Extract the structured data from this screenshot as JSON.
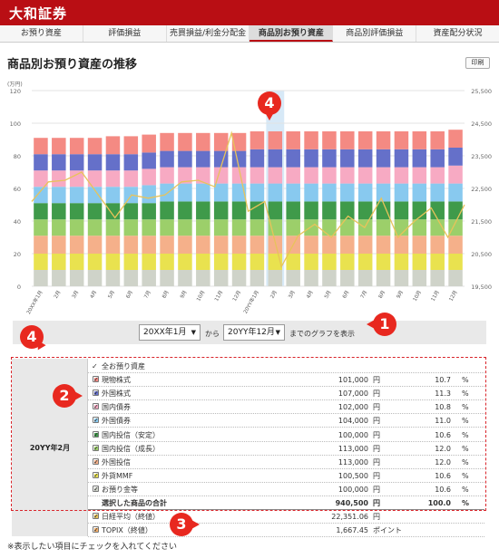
{
  "app": {
    "brand": "大和証券"
  },
  "tabs": [
    {
      "label": "お預り資産",
      "active": false
    },
    {
      "label": "評価損益",
      "active": false
    },
    {
      "label": "売買損益/利金分配金",
      "active": false
    },
    {
      "label": "商品別お預り資産",
      "active": true
    },
    {
      "label": "商品別評価損益",
      "active": false
    },
    {
      "label": "資産配分状況",
      "active": false
    }
  ],
  "page": {
    "title": "商品別お預り資産の推移",
    "print_label": "印刷"
  },
  "chart_data": {
    "type": "bar",
    "stacked": true,
    "left_axis": {
      "unit_label": "(万円)",
      "ticks": [
        "0",
        "20",
        "40",
        "60",
        "80",
        "100",
        "120"
      ],
      "ylim": [
        0,
        120
      ]
    },
    "right_axis": {
      "ticks": [
        "19,500",
        "20,500",
        "21,500",
        "22,500",
        "23,500",
        "24,500",
        "25,500"
      ],
      "ylim": [
        19500,
        25500
      ]
    },
    "categories": [
      "20XX年1月",
      "2月",
      "3月",
      "4月",
      "5月",
      "6月",
      "7月",
      "8月",
      "9月",
      "10月",
      "11月",
      "12月",
      "20YY年1月",
      "2月",
      "3月",
      "4月",
      "5月",
      "6月",
      "7月",
      "8月",
      "9月",
      "10月",
      "11月",
      "12月"
    ],
    "series": [
      {
        "color": "#cfd3c9",
        "values": [
          10,
          10,
          10,
          10,
          10,
          10,
          10,
          10,
          10,
          10,
          10,
          10,
          10,
          10,
          10,
          10,
          10,
          10,
          10,
          10,
          10,
          10,
          10,
          10
        ]
      },
      {
        "color": "#e9e24f",
        "values": [
          10,
          10,
          10,
          10,
          10,
          10,
          10,
          10,
          10,
          10,
          10,
          10,
          10,
          10,
          10,
          10,
          10,
          10,
          10,
          10,
          10,
          10,
          10,
          10
        ]
      },
      {
        "color": "#f5b08a",
        "values": [
          11,
          11,
          11,
          11,
          11,
          11,
          11,
          11,
          11,
          11,
          11,
          11,
          11,
          11,
          11,
          11,
          11,
          11,
          11,
          11,
          11,
          11,
          11,
          11
        ]
      },
      {
        "color": "#9ccf6a",
        "values": [
          10,
          10,
          10,
          10,
          10,
          10,
          10,
          10,
          10,
          10,
          10,
          10,
          10,
          10,
          10,
          10,
          10,
          10,
          10,
          10,
          10,
          10,
          10,
          10
        ]
      },
      {
        "color": "#3f9a4a",
        "values": [
          10,
          10,
          10,
          10,
          10,
          10,
          10,
          11,
          11,
          11,
          11,
          11,
          11,
          11,
          11,
          11,
          11,
          11,
          11,
          11,
          11,
          11,
          11,
          11
        ]
      },
      {
        "color": "#88c9ef",
        "values": [
          10,
          10,
          10,
          10,
          10,
          10,
          11,
          11,
          11,
          11,
          11,
          11,
          11,
          11,
          11,
          11,
          11,
          11,
          11,
          11,
          11,
          11,
          11,
          11
        ]
      },
      {
        "color": "#f7aac3",
        "values": [
          10,
          10,
          10,
          10,
          10,
          10,
          10,
          10,
          10,
          10,
          10,
          10,
          10,
          10,
          10,
          10,
          10,
          10,
          10,
          10,
          10,
          10,
          10,
          11
        ]
      },
      {
        "color": "#6570c9",
        "values": [
          10,
          10,
          10,
          10,
          10,
          10,
          10,
          10,
          10,
          10,
          10,
          10,
          11,
          11,
          11,
          11,
          11,
          11,
          11,
          11,
          11,
          11,
          11,
          11
        ]
      },
      {
        "color": "#f48a83",
        "values": [
          10,
          10,
          10,
          10,
          11,
          11,
          11,
          11,
          11,
          11,
          11,
          11,
          11,
          11,
          11,
          11,
          11,
          11,
          11,
          11,
          11,
          11,
          11,
          11
        ]
      }
    ],
    "line": {
      "color": "#e8c35a",
      "values": [
        22100,
        22700,
        22750,
        23000,
        22300,
        21600,
        22300,
        22200,
        22300,
        22700,
        22750,
        22550,
        24200,
        21800,
        22100,
        20100,
        21050,
        21400,
        21000,
        21650,
        21300,
        22200,
        21000,
        21500,
        21900,
        21000,
        22000
      ]
    },
    "highlight_index": 13,
    "highlight_color": "#d7e9f7"
  },
  "range_control": {
    "start_value": "20XX年1月",
    "from_text": "から",
    "end_value": "20YY年12月",
    "suffix_text": "までのグラフを表示"
  },
  "table": {
    "period_label": "20YY年2月",
    "rows": [
      {
        "name": "全お預り資産",
        "color": "",
        "amount": "",
        "unit": "",
        "pct": "",
        "pct_unit": ""
      },
      {
        "name": "現物株式",
        "color": "#f48a83",
        "amount": "101,000",
        "unit": "円",
        "pct": "10.7",
        "pct_unit": "%"
      },
      {
        "name": "外国株式",
        "color": "#6570c9",
        "amount": "107,000",
        "unit": "円",
        "pct": "11.3",
        "pct_unit": "%"
      },
      {
        "name": "国内債券",
        "color": "#f7aac3",
        "amount": "102,000",
        "unit": "円",
        "pct": "10.8",
        "pct_unit": "%"
      },
      {
        "name": "外国債券",
        "color": "#88c9ef",
        "amount": "104,000",
        "unit": "円",
        "pct": "11.0",
        "pct_unit": "%"
      },
      {
        "name": "国内投信（安定）",
        "color": "#3f9a4a",
        "amount": "100,000",
        "unit": "円",
        "pct": "10.6",
        "pct_unit": "%"
      },
      {
        "name": "国内投信（成長）",
        "color": "#9ccf6a",
        "amount": "113,000",
        "unit": "円",
        "pct": "12.0",
        "pct_unit": "%"
      },
      {
        "name": "外国投信",
        "color": "#f5b08a",
        "amount": "113,000",
        "unit": "円",
        "pct": "12.0",
        "pct_unit": "%"
      },
      {
        "name": "外貨MMF",
        "color": "#e9e24f",
        "amount": "100,500",
        "unit": "円",
        "pct": "10.6",
        "pct_unit": "%"
      },
      {
        "name": "お預り金等",
        "color": "#cfd3c9",
        "amount": "100,000",
        "unit": "円",
        "pct": "10.6",
        "pct_unit": "%"
      },
      {
        "name": "選択した商品の合計",
        "color": "",
        "amount": "940,500",
        "unit": "円",
        "pct": "100.0",
        "pct_unit": "%",
        "total": true
      },
      {
        "name": "日経平均（終値）",
        "color": "#e8c35a",
        "amount": "22,351.06",
        "unit": "円",
        "pct": "",
        "pct_unit": ""
      },
      {
        "name": "TOPIX（終値）",
        "color": "#f5b06a",
        "amount": "1,667.45",
        "unit": "ポイント",
        "pct": "",
        "pct_unit": ""
      }
    ]
  },
  "footnote": "※表示したい項目にチェックを入れてください",
  "annotations": [
    {
      "label": "4"
    },
    {
      "label": "1"
    },
    {
      "label": "4"
    },
    {
      "label": "2"
    },
    {
      "label": "3"
    }
  ]
}
